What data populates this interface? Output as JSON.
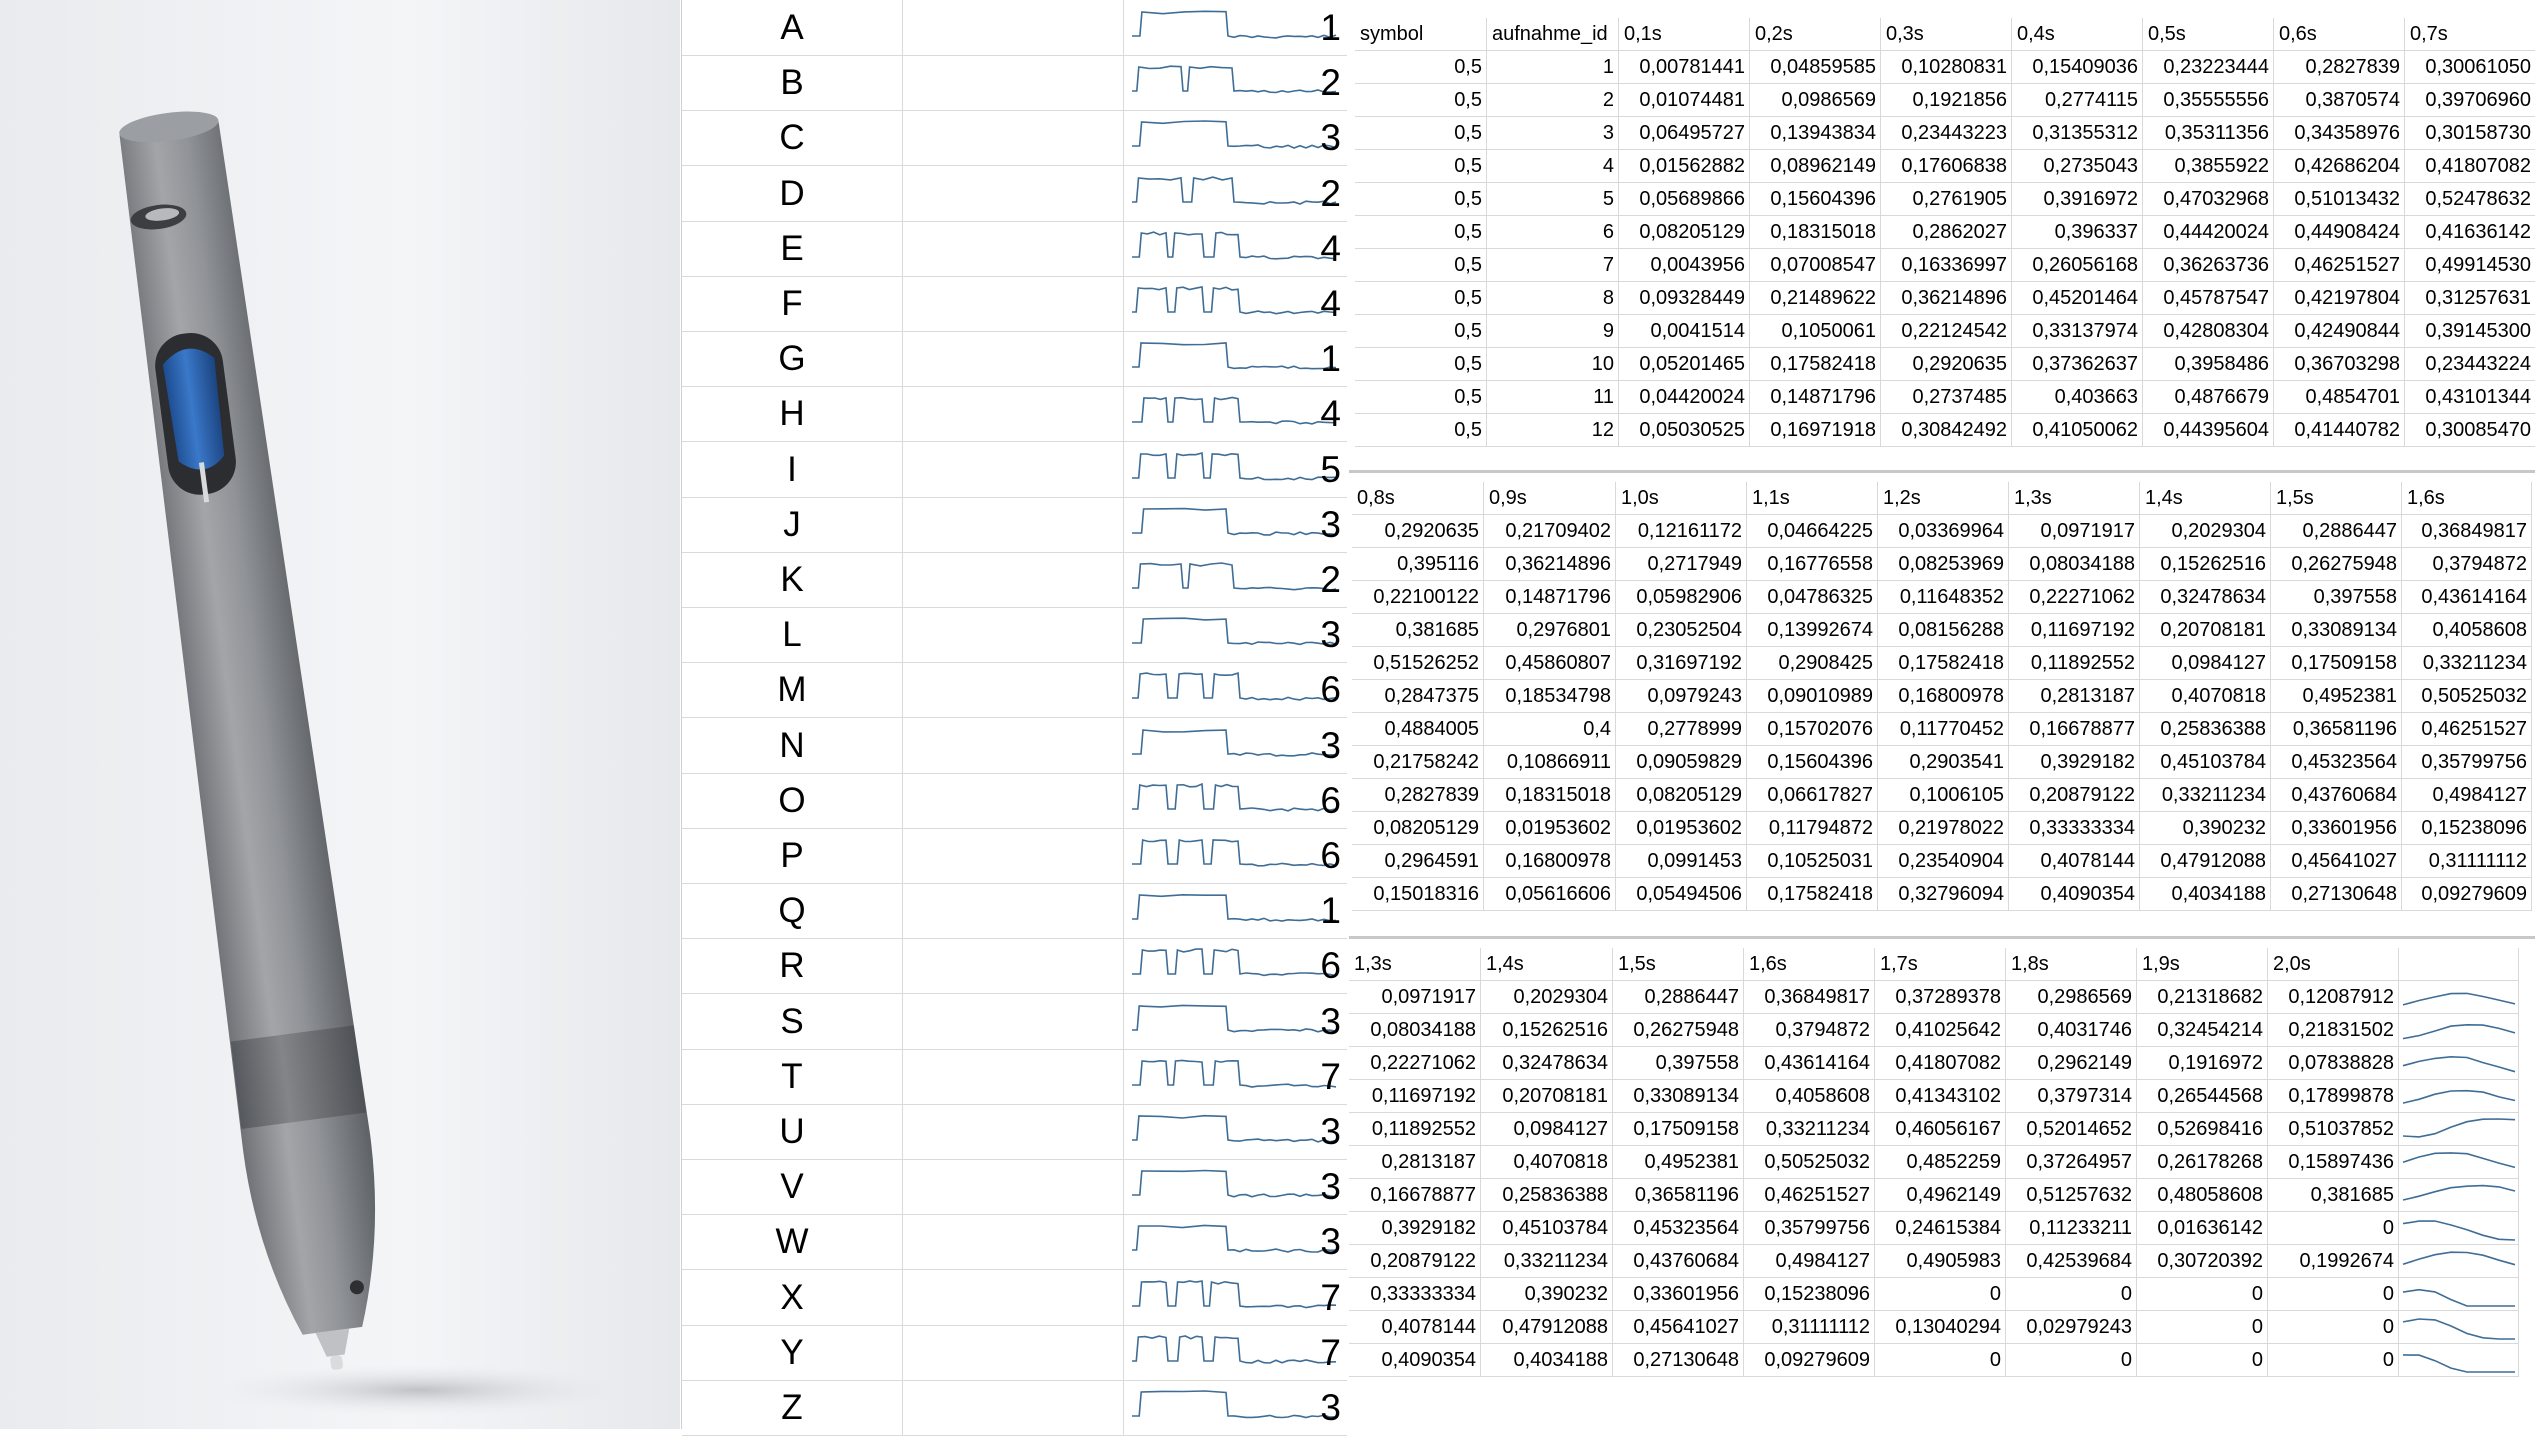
{
  "letters_table": [
    {
      "letter": "A",
      "count": "1"
    },
    {
      "letter": "B",
      "count": "2"
    },
    {
      "letter": "C",
      "count": "3"
    },
    {
      "letter": "D",
      "count": "2"
    },
    {
      "letter": "E",
      "count": "4"
    },
    {
      "letter": "F",
      "count": "4"
    },
    {
      "letter": "G",
      "count": "1"
    },
    {
      "letter": "H",
      "count": "4"
    },
    {
      "letter": "I",
      "count": "5"
    },
    {
      "letter": "J",
      "count": "3"
    },
    {
      "letter": "K",
      "count": "2"
    },
    {
      "letter": "L",
      "count": "3"
    },
    {
      "letter": "M",
      "count": "6"
    },
    {
      "letter": "N",
      "count": "3"
    },
    {
      "letter": "O",
      "count": "6"
    },
    {
      "letter": "P",
      "count": "6"
    },
    {
      "letter": "Q",
      "count": "1"
    },
    {
      "letter": "R",
      "count": "6"
    },
    {
      "letter": "S",
      "count": "3"
    },
    {
      "letter": "T",
      "count": "7"
    },
    {
      "letter": "U",
      "count": "3"
    },
    {
      "letter": "V",
      "count": "3"
    },
    {
      "letter": "W",
      "count": "3"
    },
    {
      "letter": "X",
      "count": "7"
    },
    {
      "letter": "Y",
      "count": "7"
    },
    {
      "letter": "Z",
      "count": "3"
    }
  ],
  "table1": {
    "headers": [
      "symbol",
      "aufnahme_id",
      "0,1s",
      "0,2s",
      "0,3s",
      "0,4s",
      "0,5s",
      "0,6s",
      "0,7s"
    ],
    "rows": [
      [
        "0,5",
        "1",
        "0,00781441",
        "0,04859585",
        "0,10280831",
        "0,15409036",
        "0,23223444",
        "0,2827839",
        "0,30061050"
      ],
      [
        "0,5",
        "2",
        "0,01074481",
        "0,0986569",
        "0,1921856",
        "0,2774115",
        "0,35555556",
        "0,3870574",
        "0,39706960"
      ],
      [
        "0,5",
        "3",
        "0,06495727",
        "0,13943834",
        "0,23443223",
        "0,31355312",
        "0,35311356",
        "0,34358976",
        "0,30158730"
      ],
      [
        "0,5",
        "4",
        "0,01562882",
        "0,08962149",
        "0,17606838",
        "0,2735043",
        "0,3855922",
        "0,42686204",
        "0,41807082"
      ],
      [
        "0,5",
        "5",
        "0,05689866",
        "0,15604396",
        "0,2761905",
        "0,3916972",
        "0,47032968",
        "0,51013432",
        "0,52478632"
      ],
      [
        "0,5",
        "6",
        "0,08205129",
        "0,18315018",
        "0,2862027",
        "0,396337",
        "0,44420024",
        "0,44908424",
        "0,41636142"
      ],
      [
        "0,5",
        "7",
        "0,0043956",
        "0,07008547",
        "0,16336997",
        "0,26056168",
        "0,36263736",
        "0,46251527",
        "0,49914530"
      ],
      [
        "0,5",
        "8",
        "0,09328449",
        "0,21489622",
        "0,36214896",
        "0,45201464",
        "0,45787547",
        "0,42197804",
        "0,31257631"
      ],
      [
        "0,5",
        "9",
        "0,0041514",
        "0,1050061",
        "0,22124542",
        "0,33137974",
        "0,42808304",
        "0,42490844",
        "0,39145300"
      ],
      [
        "0,5",
        "10",
        "0,05201465",
        "0,17582418",
        "0,2920635",
        "0,37362637",
        "0,3958486",
        "0,36703298",
        "0,23443224"
      ],
      [
        "0,5",
        "11",
        "0,04420024",
        "0,14871796",
        "0,2737485",
        "0,403663",
        "0,4876679",
        "0,4854701",
        "0,43101344"
      ],
      [
        "0,5",
        "12",
        "0,05030525",
        "0,16971918",
        "0,30842492",
        "0,41050062",
        "0,44395604",
        "0,41440782",
        "0,30085470"
      ]
    ]
  },
  "table2": {
    "headers": [
      "0,8s",
      "0,9s",
      "1,0s",
      "1,1s",
      "1,2s",
      "1,3s",
      "1,4s",
      "1,5s",
      "1,6s"
    ],
    "rows": [
      [
        "0,2920635",
        "0,21709402",
        "0,12161172",
        "0,04664225",
        "0,03369964",
        "0,0971917",
        "0,2029304",
        "0,2886447",
        "0,36849817"
      ],
      [
        "0,395116",
        "0,36214896",
        "0,2717949",
        "0,16776558",
        "0,08253969",
        "0,08034188",
        "0,15262516",
        "0,26275948",
        "0,3794872"
      ],
      [
        "0,22100122",
        "0,14871796",
        "0,05982906",
        "0,04786325",
        "0,11648352",
        "0,22271062",
        "0,32478634",
        "0,397558",
        "0,43614164"
      ],
      [
        "0,381685",
        "0,2976801",
        "0,23052504",
        "0,13992674",
        "0,08156288",
        "0,11697192",
        "0,20708181",
        "0,33089134",
        "0,4058608"
      ],
      [
        "0,51526252",
        "0,45860807",
        "0,31697192",
        "0,2908425",
        "0,17582418",
        "0,11892552",
        "0,0984127",
        "0,17509158",
        "0,33211234"
      ],
      [
        "0,2847375",
        "0,18534798",
        "0,0979243",
        "0,09010989",
        "0,16800978",
        "0,2813187",
        "0,4070818",
        "0,4952381",
        "0,50525032"
      ],
      [
        "0,4884005",
        "0,4",
        "0,2778999",
        "0,15702076",
        "0,11770452",
        "0,16678877",
        "0,25836388",
        "0,36581196",
        "0,46251527"
      ],
      [
        "0,21758242",
        "0,10866911",
        "0,09059829",
        "0,15604396",
        "0,2903541",
        "0,3929182",
        "0,45103784",
        "0,45323564",
        "0,35799756"
      ],
      [
        "0,2827839",
        "0,18315018",
        "0,08205129",
        "0,06617827",
        "0,1006105",
        "0,20879122",
        "0,33211234",
        "0,43760684",
        "0,4984127"
      ],
      [
        "0,08205129",
        "0,01953602",
        "0,01953602",
        "0,11794872",
        "0,21978022",
        "0,33333334",
        "0,390232",
        "0,33601956",
        "0,15238096"
      ],
      [
        "0,2964591",
        "0,16800978",
        "0,0991453",
        "0,10525031",
        "0,23540904",
        "0,4078144",
        "0,47912088",
        "0,45641027",
        "0,31111112"
      ],
      [
        "0,15018316",
        "0,05616606",
        "0,05494506",
        "0,17582418",
        "0,32796094",
        "0,4090354",
        "0,4034188",
        "0,27130648",
        "0,09279609"
      ]
    ]
  },
  "table3": {
    "headers": [
      "1,3s",
      "1,4s",
      "1,5s",
      "1,6s",
      "1,7s",
      "1,8s",
      "1,9s",
      "2,0s",
      ""
    ],
    "rows": [
      [
        "0,0971917",
        "0,2029304",
        "0,2886447",
        "0,36849817",
        "0,37289378",
        "0,2986569",
        "0,21318682",
        "0,12087912"
      ],
      [
        "0,08034188",
        "0,15262516",
        "0,26275948",
        "0,3794872",
        "0,41025642",
        "0,4031746",
        "0,32454214",
        "0,21831502"
      ],
      [
        "0,22271062",
        "0,32478634",
        "0,397558",
        "0,43614164",
        "0,41807082",
        "0,2962149",
        "0,1916972",
        "0,07838828"
      ],
      [
        "0,11697192",
        "0,20708181",
        "0,33089134",
        "0,4058608",
        "0,41343102",
        "0,3797314",
        "0,26544568",
        "0,17899878"
      ],
      [
        "0,11892552",
        "0,0984127",
        "0,17509158",
        "0,33211234",
        "0,46056167",
        "0,52014652",
        "0,52698416",
        "0,51037852"
      ],
      [
        "0,2813187",
        "0,4070818",
        "0,4952381",
        "0,50525032",
        "0,4852259",
        "0,37264957",
        "0,26178268",
        "0,15897436"
      ],
      [
        "0,16678877",
        "0,25836388",
        "0,36581196",
        "0,46251527",
        "0,4962149",
        "0,51257632",
        "0,48058608",
        "0,381685"
      ],
      [
        "0,3929182",
        "0,45103784",
        "0,45323564",
        "0,35799756",
        "0,24615384",
        "0,11233211",
        "0,01636142",
        "0"
      ],
      [
        "0,20879122",
        "0,33211234",
        "0,43760684",
        "0,4984127",
        "0,4905983",
        "0,42539684",
        "0,30720392",
        "0,1992674"
      ],
      [
        "0,33333334",
        "0,390232",
        "0,33601956",
        "0,15238096",
        "0",
        "0",
        "0",
        "0"
      ],
      [
        "0,4078144",
        "0,47912088",
        "0,45641027",
        "0,31111112",
        "0,13040294",
        "0,02979243",
        "0",
        "0"
      ],
      [
        "0,4090354",
        "0,4034188",
        "0,27130648",
        "0,09279609",
        "0",
        "0",
        "0",
        "0"
      ]
    ]
  },
  "colors": {
    "spark": "#3f6d96",
    "pen_body": "#8e9094",
    "pen_button": "#2f66b0"
  },
  "icons": {
    "photo": "pen-device-photo"
  }
}
